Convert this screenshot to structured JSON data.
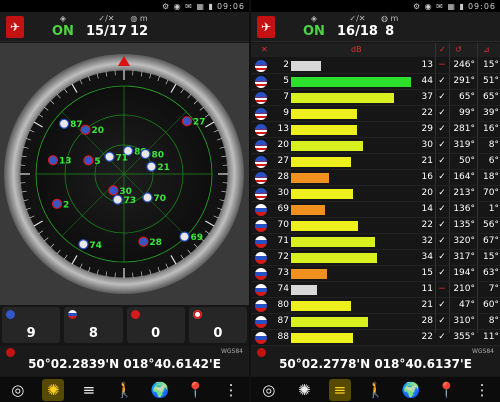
{
  "status": {
    "time": "09:06"
  },
  "left": {
    "header": {
      "fix_status": "ON",
      "sat_counts": "15/17",
      "meter_value": "12"
    },
    "compass": {
      "satellites": [
        {
          "id": "88",
          "flag": "ru",
          "az": 10,
          "el": 66
        },
        {
          "id": "27",
          "flag": "us",
          "az": 50,
          "el": 6
        },
        {
          "id": "20",
          "flag": "us",
          "az": 319,
          "el": 30
        },
        {
          "id": "87",
          "flag": "ru",
          "az": 310,
          "el": 10
        },
        {
          "id": "5",
          "flag": "us",
          "az": 291,
          "el": 51
        },
        {
          "id": "71",
          "flag": "ru",
          "az": 320,
          "el": 67
        },
        {
          "id": "80",
          "flag": "ru",
          "az": 47,
          "el": 60
        },
        {
          "id": "21",
          "flag": "ru",
          "az": 75,
          "el": 61
        },
        {
          "id": "13",
          "flag": "us",
          "az": 281,
          "el": 16
        },
        {
          "id": "30",
          "flag": "us",
          "az": 213,
          "el": 70
        },
        {
          "id": "73",
          "flag": "ru",
          "az": 194,
          "el": 63
        },
        {
          "id": "70",
          "flag": "ru",
          "az": 135,
          "el": 56
        },
        {
          "id": "2",
          "flag": "us",
          "az": 246,
          "el": 15
        },
        {
          "id": "28",
          "flag": "us",
          "az": 164,
          "el": 18
        },
        {
          "id": "74",
          "flag": "ru",
          "az": 210,
          "el": 7
        },
        {
          "id": "69",
          "flag": "ru",
          "az": 136,
          "el": 1
        }
      ]
    },
    "constellations": [
      {
        "name": "gps",
        "count": "9",
        "color": "#3456c8"
      },
      {
        "name": "glonass",
        "count": "8",
        "color": "#d0d0d0"
      },
      {
        "name": "beidou",
        "count": "0",
        "color": "#d41a1a"
      },
      {
        "name": "galileo",
        "count": "0",
        "color": "#e0e0e0"
      }
    ],
    "coords": {
      "datum": "WGS84",
      "text": "50°02.2839'N  018°40.6142'E"
    }
  },
  "right": {
    "header": {
      "fix_status": "ON",
      "sat_counts": "16/18",
      "meter_value": "8"
    },
    "table_columns": [
      "",
      "",
      "dB",
      "",
      "",
      ""
    ],
    "rows": [
      {
        "flag": "us",
        "id": "2",
        "snr": "13",
        "fix": "−",
        "az": "246°",
        "el": "15°",
        "bar": 0.25,
        "color": "#d8d8d8"
      },
      {
        "flag": "us",
        "id": "5",
        "snr": "44",
        "fix": "✓",
        "az": "291°",
        "el": "51°",
        "bar": 1.0,
        "color": "#2ee02e"
      },
      {
        "flag": "us",
        "id": "7",
        "snr": "37",
        "fix": "✓",
        "az": "65°",
        "el": "65°",
        "bar": 0.86,
        "color": "#d8f01e"
      },
      {
        "flag": "us",
        "id": "9",
        "snr": "22",
        "fix": "✓",
        "az": "99°",
        "el": "39°",
        "bar": 0.55,
        "color": "#eef01e"
      },
      {
        "flag": "us",
        "id": "13",
        "snr": "29",
        "fix": "✓",
        "az": "281°",
        "el": "16°",
        "bar": 0.55,
        "color": "#eef01e"
      },
      {
        "flag": "us",
        "id": "20",
        "snr": "30",
        "fix": "✓",
        "az": "319°",
        "el": "8°",
        "bar": 0.6,
        "color": "#d8f01e"
      },
      {
        "flag": "us",
        "id": "27",
        "snr": "21",
        "fix": "✓",
        "az": "50°",
        "el": "6°",
        "bar": 0.5,
        "color": "#eef01e"
      },
      {
        "flag": "us",
        "id": "28",
        "snr": "16",
        "fix": "✓",
        "az": "164°",
        "el": "18°",
        "bar": 0.32,
        "color": "#f0901e"
      },
      {
        "flag": "us",
        "id": "30",
        "snr": "20",
        "fix": "✓",
        "az": "213°",
        "el": "70°",
        "bar": 0.52,
        "color": "#eef01e"
      },
      {
        "flag": "ru",
        "id": "69",
        "snr": "14",
        "fix": "✓",
        "az": "136°",
        "el": "1°",
        "bar": 0.28,
        "color": "#f0901e"
      },
      {
        "flag": "ru",
        "id": "70",
        "snr": "22",
        "fix": "✓",
        "az": "135°",
        "el": "56°",
        "bar": 0.56,
        "color": "#eef01e"
      },
      {
        "flag": "ru",
        "id": "71",
        "snr": "32",
        "fix": "✓",
        "az": "320°",
        "el": "67°",
        "bar": 0.7,
        "color": "#d8f01e"
      },
      {
        "flag": "ru",
        "id": "72",
        "snr": "34",
        "fix": "✓",
        "az": "317°",
        "el": "15°",
        "bar": 0.72,
        "color": "#d8f01e"
      },
      {
        "flag": "ru",
        "id": "73",
        "snr": "15",
        "fix": "✓",
        "az": "194°",
        "el": "63°",
        "bar": 0.3,
        "color": "#f0901e"
      },
      {
        "flag": "ru",
        "id": "74",
        "snr": "11",
        "fix": "−",
        "az": "210°",
        "el": "7°",
        "bar": 0.22,
        "color": "#d8d8d8"
      },
      {
        "flag": "ru",
        "id": "80",
        "snr": "21",
        "fix": "✓",
        "az": "47°",
        "el": "60°",
        "bar": 0.5,
        "color": "#eef01e"
      },
      {
        "flag": "ru",
        "id": "87",
        "snr": "28",
        "fix": "✓",
        "az": "310°",
        "el": "8°",
        "bar": 0.64,
        "color": "#d8f01e"
      },
      {
        "flag": "ru",
        "id": "88",
        "snr": "22",
        "fix": "✓",
        "az": "355°",
        "el": "11°",
        "bar": 0.52,
        "color": "#eef01e"
      }
    ],
    "coords": {
      "datum": "WGS84",
      "text": "50°02.2778'N  018°40.6137'E"
    }
  },
  "nav": [
    {
      "icon": "compass-icon",
      "glyph": "◎"
    },
    {
      "icon": "radar-icon",
      "glyph": "✺"
    },
    {
      "icon": "bars-icon",
      "glyph": "≡"
    },
    {
      "icon": "walk-icon",
      "glyph": "🚶"
    },
    {
      "icon": "globe-icon",
      "glyph": "🌍"
    },
    {
      "icon": "location-pin-icon",
      "glyph": "📍"
    },
    {
      "icon": "more-icon",
      "glyph": "⋮"
    }
  ]
}
